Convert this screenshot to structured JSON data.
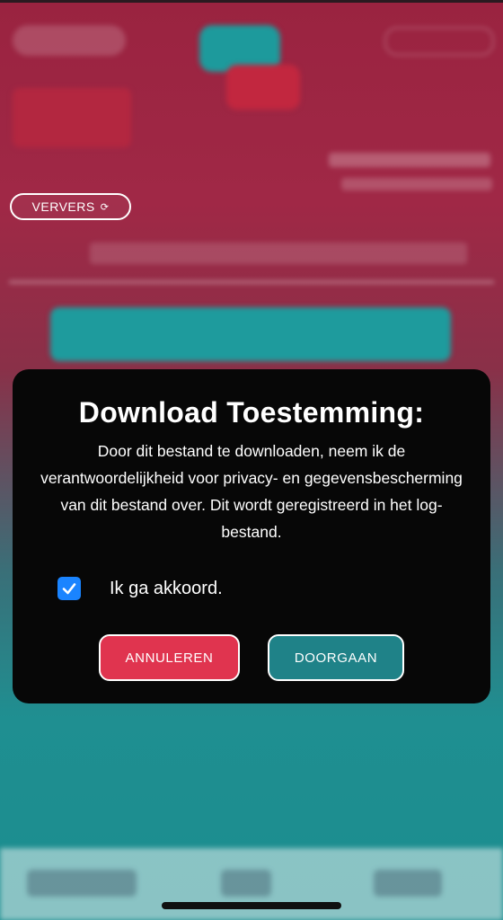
{
  "background": {
    "refresh_label": "VERVERS",
    "refresh_icon": "refresh-icon"
  },
  "dialog": {
    "title": "Download Toestemming:",
    "body": "Door dit bestand te downloaden, neem ik de verantwoordelijkheid voor privacy- en gegevensbescherming van dit bestand over. Dit wordt geregistreerd in het log-bestand.",
    "agree_label": "Ik ga akkoord.",
    "agree_checked": true,
    "cancel_label": "ANNULEREN",
    "continue_label": "DOORGAAN"
  },
  "colors": {
    "cancel": "#e0344f",
    "continue": "#1f8288",
    "checkbox": "#1a84ff",
    "modal_bg": "#070707"
  }
}
